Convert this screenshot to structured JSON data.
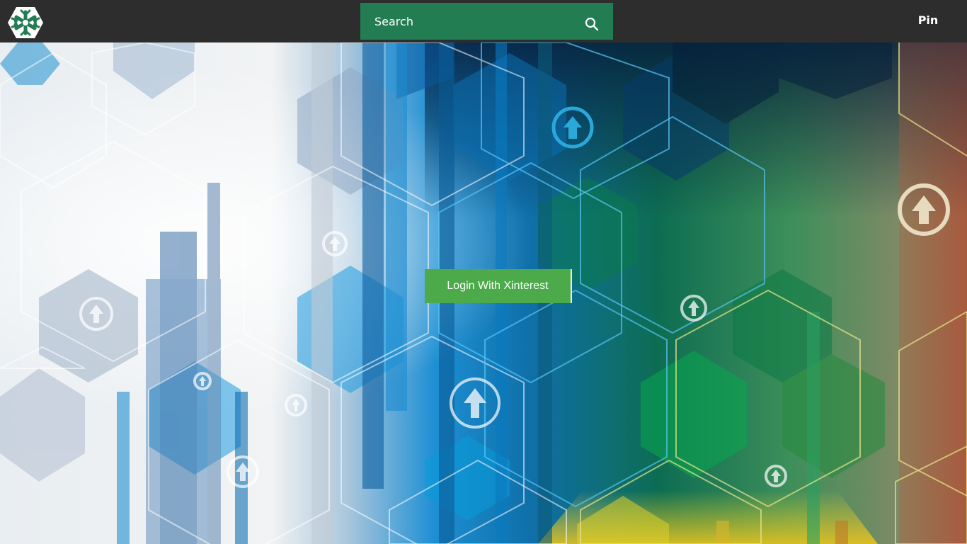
{
  "header": {
    "logo_icon": "snowflake-hexagon-logo-icon",
    "search": {
      "placeholder": "Search",
      "icon": "search-icon"
    },
    "pin_label": "Pin"
  },
  "hero": {
    "background": "hexagon-technology-abstract",
    "login_button_label": "Login With Xinterest"
  },
  "colors": {
    "topbar": "#2d2d2d",
    "search_bg": "#237d53",
    "login_button": "#4caa4a"
  }
}
